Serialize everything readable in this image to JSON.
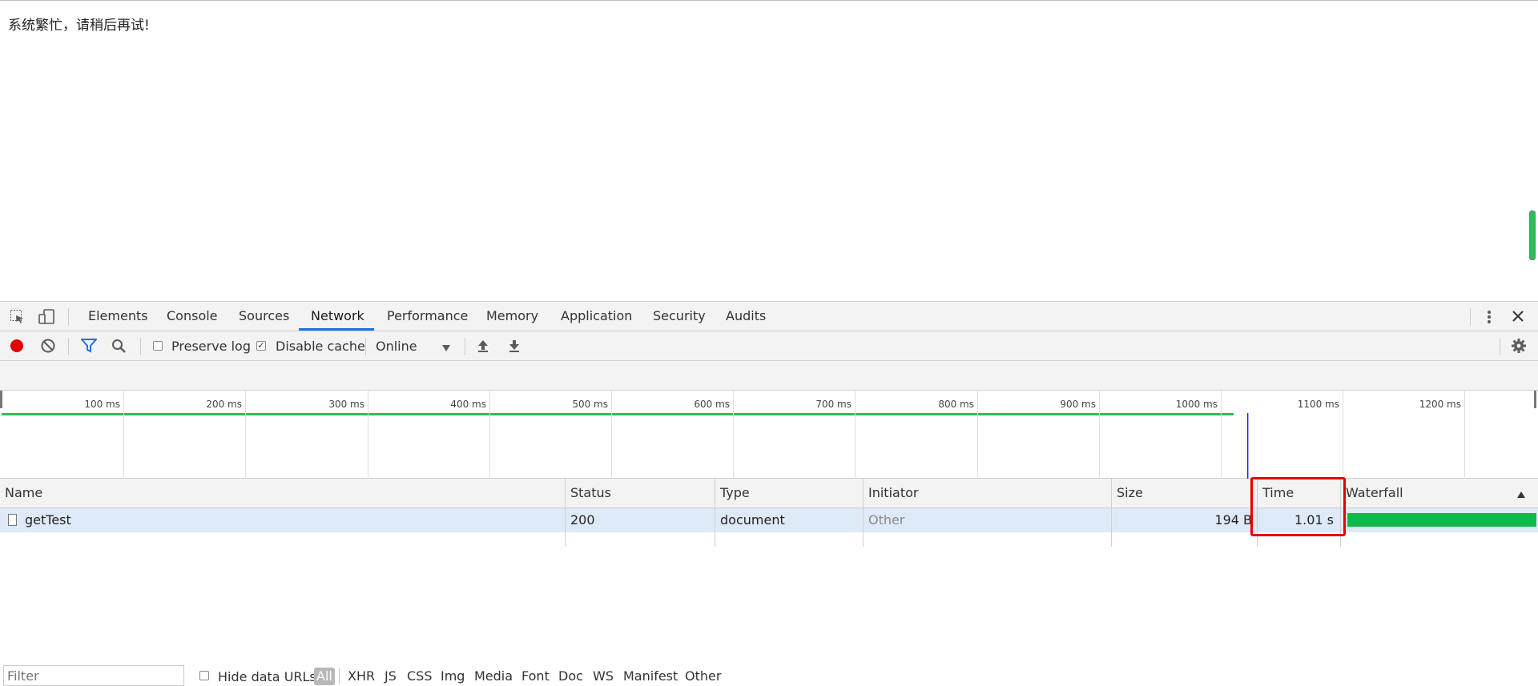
{
  "page": {
    "message": "系统繁忙，请稍后再试!"
  },
  "devtools": {
    "tabs": [
      "Elements",
      "Console",
      "Sources",
      "Network",
      "Performance",
      "Memory",
      "Application",
      "Security",
      "Audits"
    ],
    "active_tab": "Network",
    "toolbar": {
      "preserve_log_label": "Preserve log",
      "preserve_log_checked": false,
      "disable_cache_label": "Disable cache",
      "disable_cache_checked": true,
      "throttling_value": "Online"
    },
    "filter": {
      "placeholder": "Filter",
      "hide_data_urls_label": "Hide data URLs",
      "types": [
        "All",
        "XHR",
        "JS",
        "CSS",
        "Img",
        "Media",
        "Font",
        "Doc",
        "WS",
        "Manifest",
        "Other"
      ],
      "active_type": "All"
    },
    "overview": {
      "ticks": [
        "100 ms",
        "200 ms",
        "300 ms",
        "400 ms",
        "500 ms",
        "600 ms",
        "700 ms",
        "800 ms",
        "900 ms",
        "1000 ms",
        "1100 ms",
        "1200 ms"
      ]
    },
    "table": {
      "columns": [
        "Name",
        "Status",
        "Type",
        "Initiator",
        "Size",
        "Time",
        "Waterfall"
      ],
      "rows": [
        {
          "name": "getTest",
          "status": "200",
          "type": "document",
          "initiator": "Other",
          "size": "194 B",
          "time": "1.01 s"
        }
      ],
      "sorted_column": "Waterfall",
      "highlighted_column": "Time"
    },
    "colors": {
      "waterfall_bar": "#12b84a",
      "highlight_box": "#e60000",
      "record_button": "#e00000",
      "active_tab_underline": "#1a73e8"
    }
  }
}
